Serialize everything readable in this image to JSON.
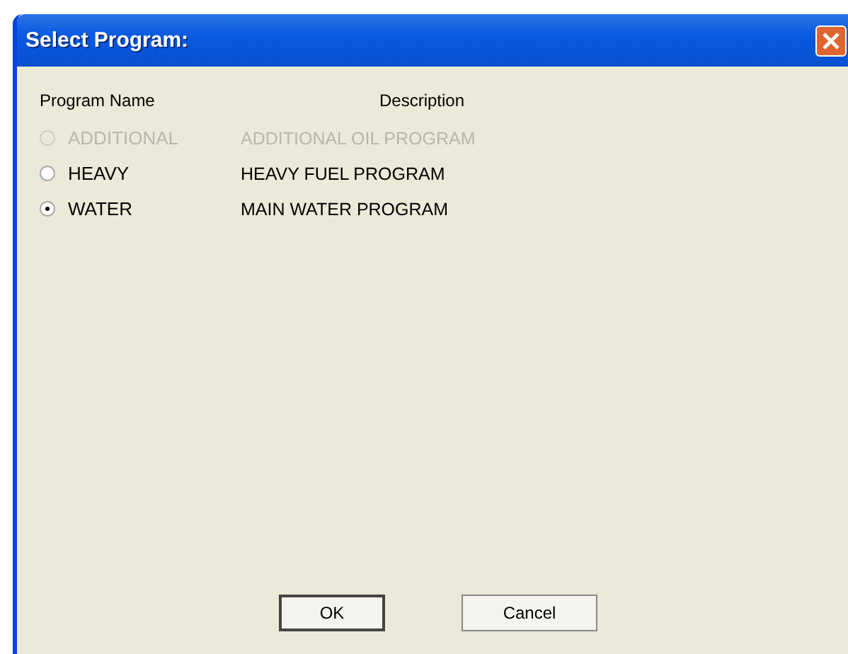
{
  "window": {
    "title": "Select Program:"
  },
  "columns": [
    "Program Name",
    "Description"
  ],
  "programs": [
    {
      "name": "ADDITIONAL",
      "description": "ADDITIONAL OIL PROGRAM",
      "selected": false,
      "disabled": true
    },
    {
      "name": "HEAVY",
      "description": "HEAVY FUEL PROGRAM",
      "selected": false,
      "disabled": false
    },
    {
      "name": "WATER",
      "description": "MAIN WATER PROGRAM",
      "selected": true,
      "disabled": false
    }
  ],
  "buttons": [
    {
      "label": "OK",
      "default": true
    },
    {
      "label": "Cancel",
      "default": false
    }
  ]
}
